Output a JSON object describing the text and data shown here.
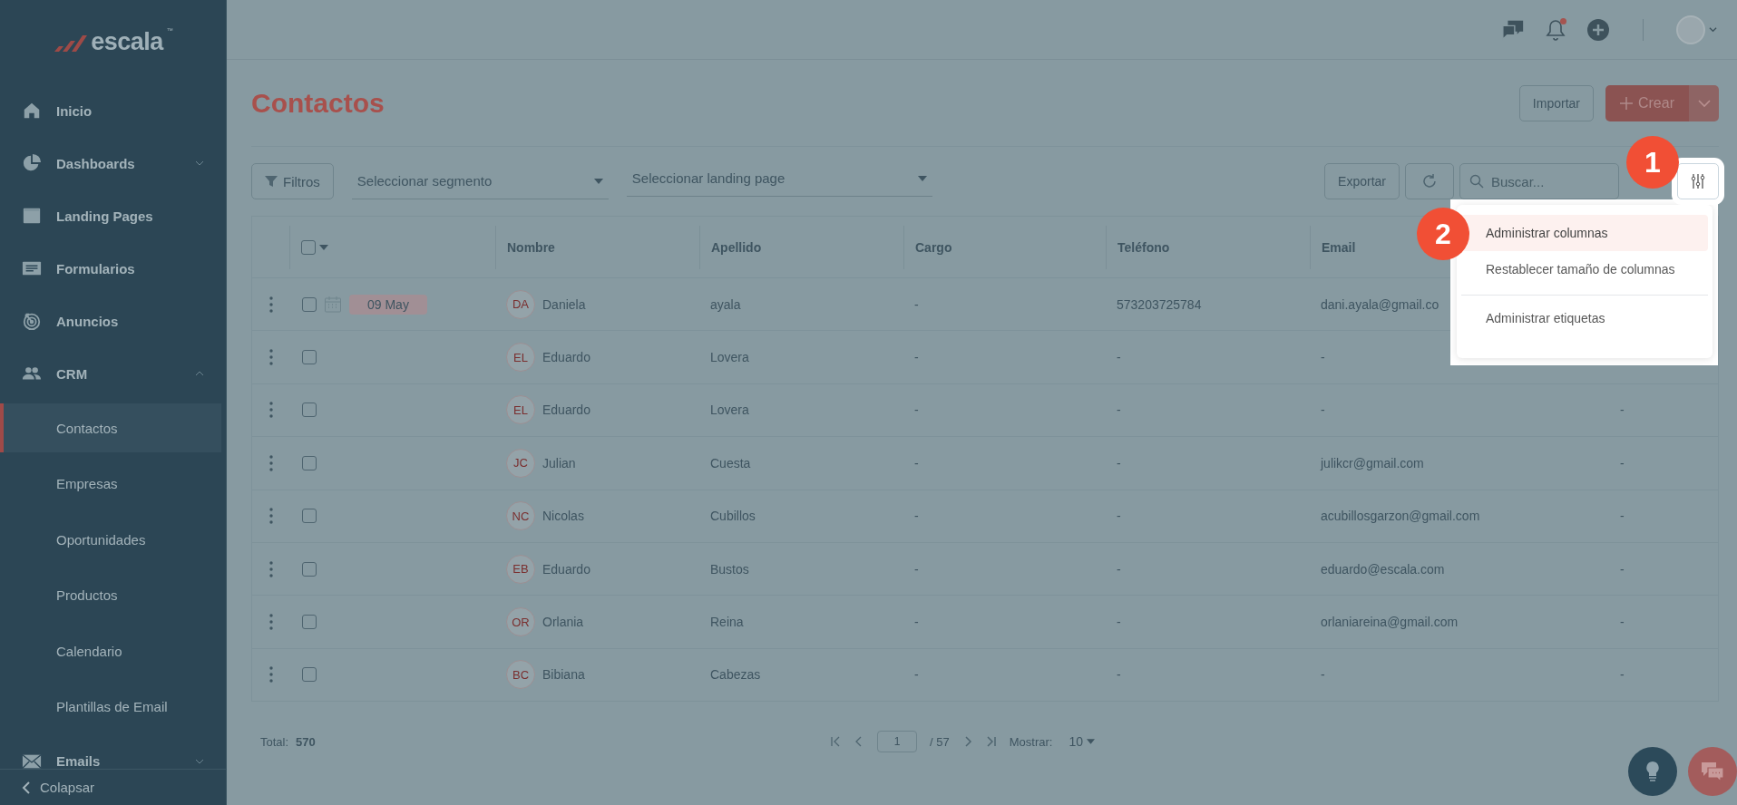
{
  "brand": {
    "name": "escala",
    "trademark": "™"
  },
  "sidebar": {
    "items": [
      {
        "label": "Inicio"
      },
      {
        "label": "Dashboards",
        "expanded": false
      },
      {
        "label": "Landing Pages"
      },
      {
        "label": "Formularios"
      },
      {
        "label": "Anuncios"
      },
      {
        "label": "CRM",
        "expanded": true,
        "children": [
          {
            "label": "Contactos",
            "selected": true
          },
          {
            "label": "Empresas",
            "selected": false
          },
          {
            "label": "Oportunidades",
            "selected": false
          },
          {
            "label": "Productos",
            "selected": false
          },
          {
            "label": "Calendario",
            "selected": false
          },
          {
            "label": "Plantillas de Email",
            "selected": false
          }
        ]
      },
      {
        "label": "Emails",
        "expanded": false
      }
    ],
    "collapse": "Colapsar"
  },
  "header": {
    "has_notification": true
  },
  "page": {
    "title": "Contactos",
    "import_button": "Importar",
    "create_button": "Crear"
  },
  "toolbar": {
    "filters_button": "Filtros",
    "segment_select": {
      "placeholder": "Seleccionar segmento"
    },
    "landing_select": {
      "placeholder": "Seleccionar landing page"
    },
    "export_button": "Exportar",
    "search": {
      "placeholder": "Buscar..."
    }
  },
  "column_menu": {
    "groups": [
      [
        {
          "label": "Administrar columnas",
          "selected": true
        },
        {
          "label": "Restablecer tamaño de columnas",
          "selected": false
        }
      ],
      [
        {
          "label": "Administrar etiquetas",
          "selected": false
        }
      ]
    ]
  },
  "callouts": [
    "1",
    "2"
  ],
  "table": {
    "select_all_checked": false,
    "columns": [
      "Nombre",
      "Apellido",
      "Cargo",
      "Teléfono",
      "Email"
    ],
    "rows": [
      {
        "checked": false,
        "date": "09 May",
        "initials": "DA",
        "cells": [
          "Daniela",
          "ayala",
          "-",
          "573203725784",
          "dani.ayala@gmail.co"
        ]
      },
      {
        "checked": false,
        "initials": "EL",
        "cells": [
          "Eduardo",
          "Lovera",
          "-",
          "-",
          "-"
        ]
      },
      {
        "checked": false,
        "initials": "EL",
        "cells": [
          "Eduardo",
          "Lovera",
          "-",
          "-",
          "-"
        ],
        "column_8": "-"
      },
      {
        "checked": false,
        "initials": "JC",
        "cells": [
          "Julian",
          "Cuesta",
          "-",
          "-",
          "julikcr@gmail.com"
        ],
        "column_8": "-"
      },
      {
        "checked": false,
        "initials": "NC",
        "cells": [
          "Nicolas",
          "Cubillos",
          "-",
          "-",
          "acubillosgarzon@gmail.com"
        ],
        "column_8": "-"
      },
      {
        "checked": false,
        "initials": "EB",
        "cells": [
          "Eduardo",
          "Bustos",
          "-",
          "-",
          "eduardo@escala.com"
        ],
        "column_8": "-"
      },
      {
        "checked": false,
        "initials": "OR",
        "cells": [
          "Orlania",
          "Reina",
          "-",
          "-",
          "orlaniareina@gmail.com"
        ],
        "column_8": "-"
      },
      {
        "checked": false,
        "initials": "BC",
        "cells": [
          "Bibiana",
          "Cabezas",
          "-",
          "-",
          "-"
        ],
        "column_8": "-"
      }
    ]
  },
  "footer": {
    "total_label": "Total:",
    "total": "570",
    "page": "1",
    "pages": "/ 57",
    "show_label": "Mostrar:",
    "page_size": "10"
  }
}
